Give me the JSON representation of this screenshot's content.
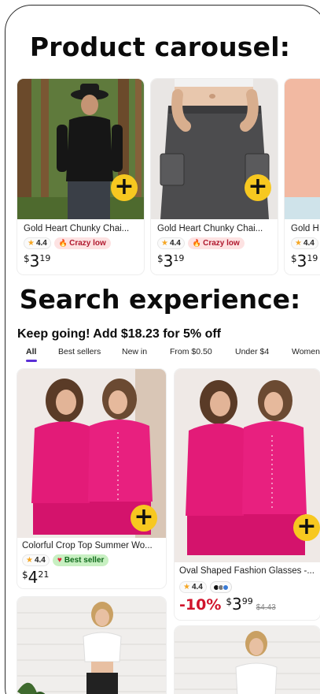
{
  "sections": {
    "carousel_title": "Product carousel:",
    "search_title": "Search experience:"
  },
  "carousel": {
    "items": [
      {
        "name": "Gold Heart Chunky Chai...",
        "rating": "4.4",
        "tag": "Crazy low",
        "currency": "$",
        "price_whole": "3",
        "price_cents": "19"
      },
      {
        "name": "Gold Heart Chunky Chai...",
        "rating": "4.4",
        "tag": "Crazy low",
        "currency": "$",
        "price_whole": "3",
        "price_cents": "19"
      },
      {
        "name": "Gold H",
        "rating": "4.4",
        "currency": "$",
        "price_whole": "3",
        "price_cents": "19"
      }
    ]
  },
  "search": {
    "promo_text": "Keep going! Add $18.23 for 5% off",
    "tabs": [
      "All",
      "Best sellers",
      "New in",
      "From $0.50",
      "Under $4",
      "Women"
    ],
    "results": [
      {
        "name": "Colorful Crop Top Summer Wo...",
        "rating": "4.4",
        "tag": "Best seller",
        "currency": "$",
        "price_whole": "4",
        "price_cents": "21"
      },
      {
        "name": "Oval Shaped Fashion Glasses -...",
        "rating": "4.4",
        "discount": "-10%",
        "currency": "$",
        "price_whole": "3",
        "price_cents": "99",
        "original_price": "$4.43"
      }
    ]
  },
  "icons": {
    "add": "+",
    "star": "★",
    "fire": "🔥",
    "heart": "♥"
  },
  "colors": {
    "add_button": "#f7c820",
    "crazy_low_bg": "#fde2e2",
    "best_seller_bg": "#c8f0c2",
    "discount": "#d0142c",
    "tab_indicator": "#5a2fd6"
  }
}
